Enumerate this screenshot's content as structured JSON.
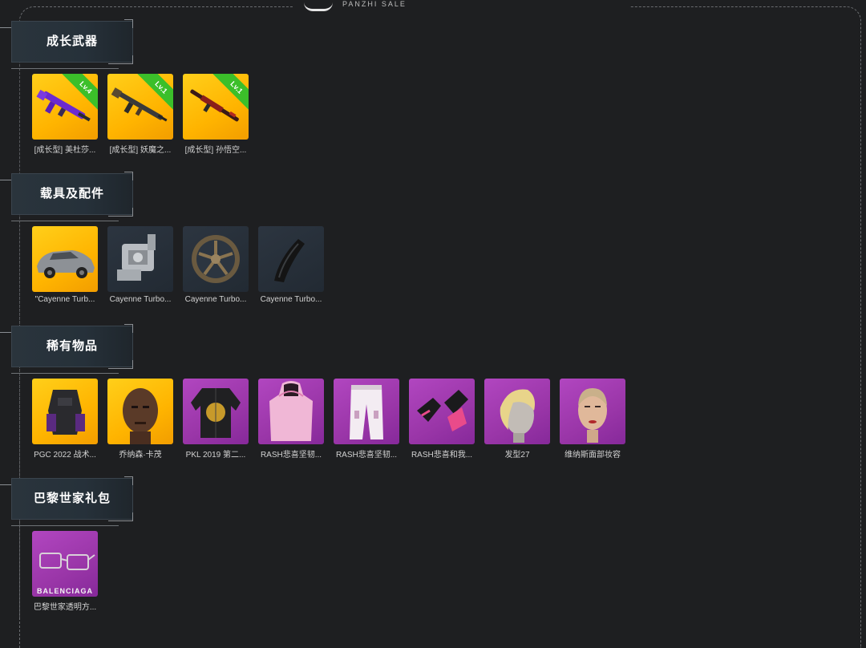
{
  "brand": {
    "sub": "PANZHI SALE"
  },
  "sections": [
    {
      "title": "成长武器",
      "items": [
        {
          "caption": "[成长型] 美杜莎...",
          "rarity": "gold",
          "badge": "Lv.4",
          "icon": "rifle-purple-icon"
        },
        {
          "caption": "[成长型] 妖魔之...",
          "rarity": "gold",
          "badge": "Lv.1",
          "icon": "rifle-dark-icon"
        },
        {
          "caption": "[成长型] 孙悟空...",
          "rarity": "gold",
          "badge": "Lv.1",
          "icon": "rifle-red-icon"
        }
      ]
    },
    {
      "title": "载具及配件",
      "items": [
        {
          "caption": "\"Cayenne Turb...",
          "rarity": "gold",
          "icon": "car-icon"
        },
        {
          "caption": "Cayenne Turbo...",
          "rarity": "dark",
          "icon": "engine-icon"
        },
        {
          "caption": "Cayenne Turbo...",
          "rarity": "dark",
          "icon": "wheel-icon"
        },
        {
          "caption": "Cayenne Turbo...",
          "rarity": "dark",
          "icon": "spoiler-icon"
        }
      ]
    },
    {
      "title": "稀有物品",
      "items": [
        {
          "caption": "PGC 2022 战术...",
          "rarity": "gold",
          "icon": "vest-icon"
        },
        {
          "caption": "乔纳森·卡茂",
          "rarity": "gold",
          "icon": "face-icon"
        },
        {
          "caption": "PKL 2019 第二...",
          "rarity": "purple",
          "icon": "jacket-icon"
        },
        {
          "caption": "RASH悲喜坚韧...",
          "rarity": "purple",
          "icon": "hoodie-icon"
        },
        {
          "caption": "RASH悲喜坚韧...",
          "rarity": "purple",
          "icon": "pants-icon"
        },
        {
          "caption": "RASH悲喜和我...",
          "rarity": "purple",
          "icon": "gloves-icon"
        },
        {
          "caption": "发型27",
          "rarity": "purple",
          "icon": "hair-icon"
        },
        {
          "caption": "维纳斯面部妆容",
          "rarity": "purple",
          "icon": "makeup-icon"
        }
      ]
    },
    {
      "title": "巴黎世家礼包",
      "items": [
        {
          "caption": "巴黎世家透明方...",
          "rarity": "purple",
          "icon": "glasses-icon",
          "brand_label": "BALENCIAGA"
        }
      ]
    }
  ]
}
